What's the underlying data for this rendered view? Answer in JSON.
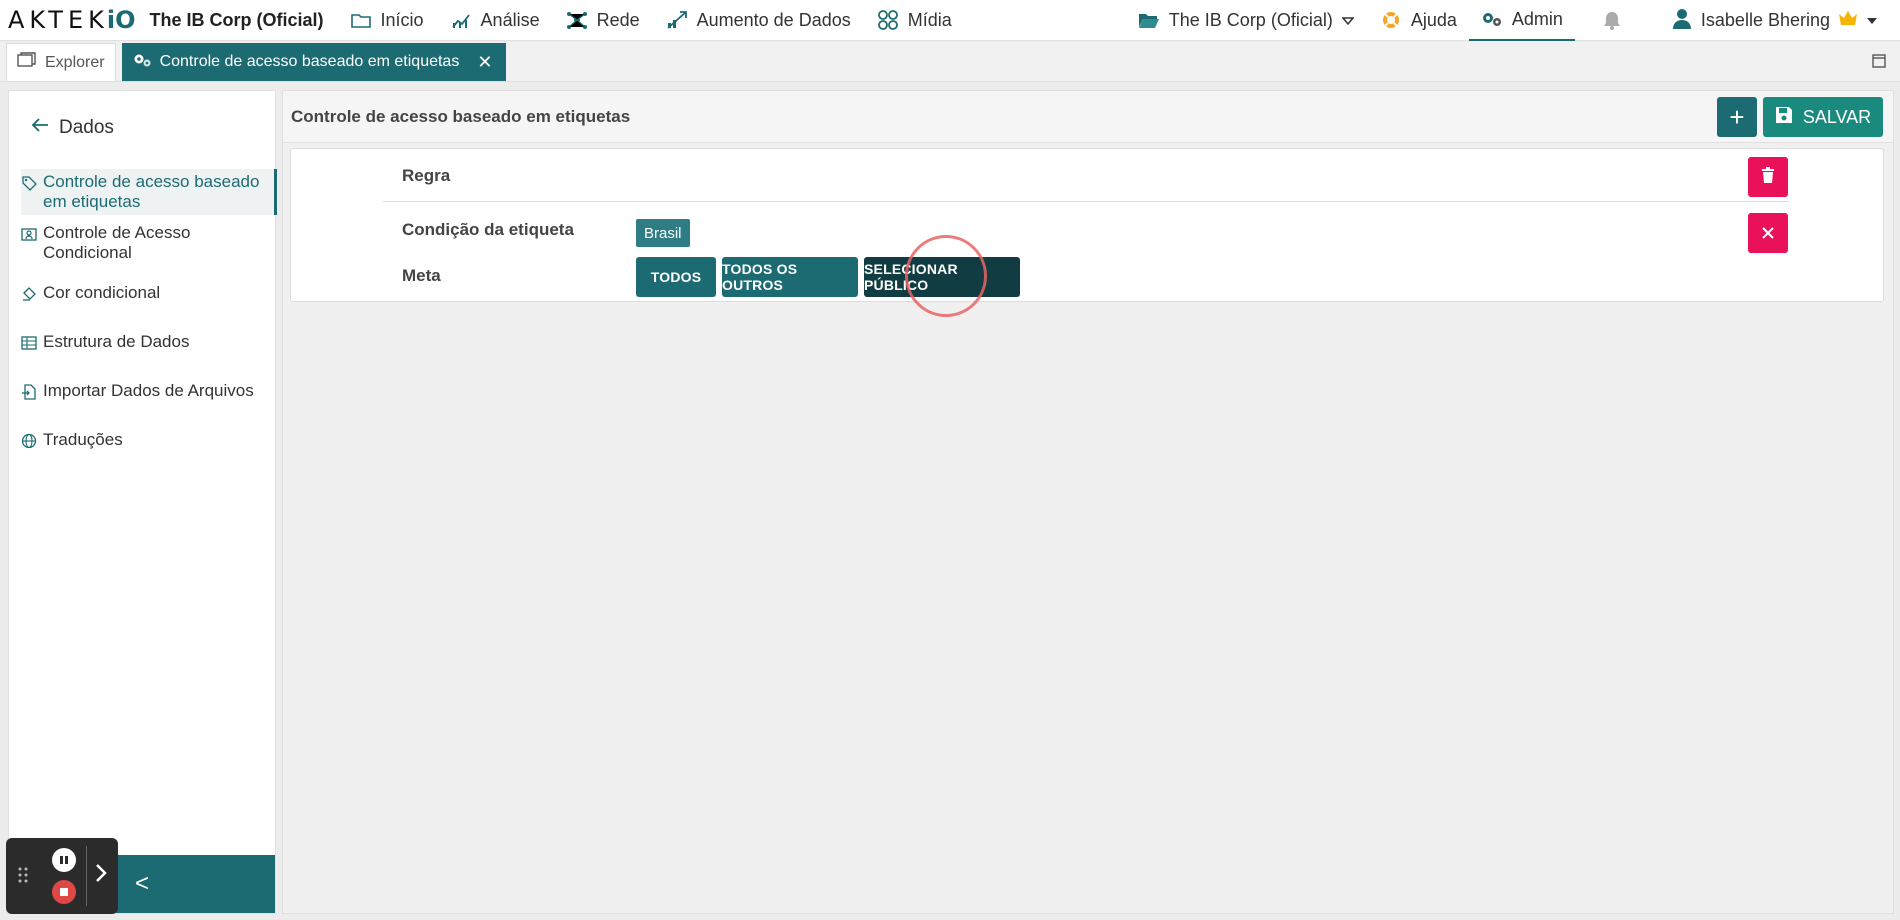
{
  "topbar": {
    "logo_text": "AKTEK",
    "logo_suffix": "iO",
    "org_name": "The IB Corp (Oficial)",
    "nav": [
      {
        "label": "Início",
        "icon": "folder-icon"
      },
      {
        "label": "Análise",
        "icon": "chart-icon"
      },
      {
        "label": "Rede",
        "icon": "network-icon"
      },
      {
        "label": "Aumento de Dados",
        "icon": "data-growth-icon"
      },
      {
        "label": "Mídia",
        "icon": "media-icon"
      }
    ],
    "org_selector": "The IB Corp (Oficial)",
    "help_label": "Ajuda",
    "admin_label": "Admin",
    "user_name": "Isabelle Bhering"
  },
  "tabs": {
    "explorer_label": "Explorer",
    "active_label": "Controle de acesso baseado em etiquetas",
    "close_glyph": "✕"
  },
  "sidebar": {
    "back_label": "Dados",
    "items": [
      {
        "label": "Controle de acesso baseado em etiquetas",
        "icon": "tag-icon",
        "active": true
      },
      {
        "label": "Controle de Acesso Condicional",
        "icon": "conditional-access-icon"
      },
      {
        "label": "Cor condicional",
        "icon": "paint-icon"
      },
      {
        "label": "Estrutura de Dados",
        "icon": "table-icon"
      },
      {
        "label": "Importar Dados de Arquivos",
        "icon": "file-import-icon"
      },
      {
        "label": "Traduções",
        "icon": "globe-icon"
      }
    ],
    "collapse_glyph": "<"
  },
  "main": {
    "title": "Controle de acesso baseado em etiquetas",
    "add_glyph": "+",
    "save_label": "SALVAR",
    "rule": {
      "rule_label": "Regra",
      "condition_label": "Condição da etiqueta",
      "condition_tag": "Brasil",
      "target_label": "Meta",
      "target_buttons": [
        "TODOS",
        "TODOS OS OUTROS",
        "SELECIONAR PÚBLICO"
      ],
      "selected_target": "SELECIONAR PÚBLICO"
    }
  },
  "colors": {
    "accent": "#1d6b72",
    "save": "#1b8a7e",
    "danger": "#e8115a"
  }
}
